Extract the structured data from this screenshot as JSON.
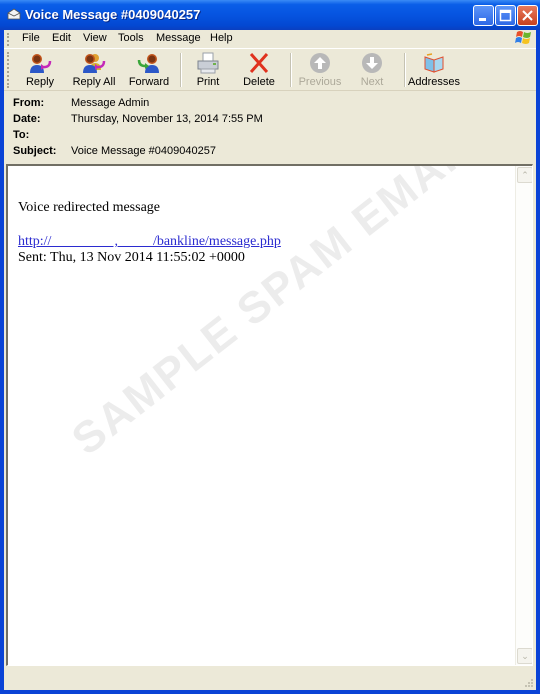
{
  "window": {
    "title": "Voice Message #0409040257",
    "controls": {
      "minimize": "minimize",
      "maximize": "maximize",
      "close": "close"
    }
  },
  "menu": {
    "items": [
      {
        "label": "File"
      },
      {
        "label": "Edit"
      },
      {
        "label": "View"
      },
      {
        "label": "Tools"
      },
      {
        "label": "Message"
      },
      {
        "label": "Help"
      }
    ]
  },
  "toolbar": {
    "buttons": [
      {
        "label": "Reply",
        "icon": "reply-icon",
        "enabled": true
      },
      {
        "label": "Reply All",
        "icon": "reply-all-icon",
        "enabled": true
      },
      {
        "label": "Forward",
        "icon": "forward-icon",
        "enabled": true
      },
      {
        "label": "Print",
        "icon": "printer-icon",
        "enabled": true
      },
      {
        "label": "Delete",
        "icon": "delete-x-icon",
        "enabled": true
      },
      {
        "label": "Previous",
        "icon": "up-arrow-icon",
        "enabled": false
      },
      {
        "label": "Next",
        "icon": "down-arrow-icon",
        "enabled": false
      },
      {
        "label": "Addresses",
        "icon": "address-book-icon",
        "enabled": true
      }
    ]
  },
  "headers": {
    "from_label": "From:",
    "from": "Message Admin",
    "date_label": "Date:",
    "date": "Thursday, November 13, 2014 7:55 PM",
    "to_label": "To:",
    "to": "",
    "subject_label": "Subject:",
    "subject": "Voice Message #0409040257"
  },
  "body": {
    "line1": "Voice redirected message",
    "link": "http://                  ,          /bankline/message.php",
    "sent": "Sent: Thu, 13 Nov 2014 11:55:02 +0000"
  },
  "watermark": "SAMPLE SPAM EMAIL",
  "colors": {
    "titlebar": "#0654e0",
    "chrome": "#ece9d8",
    "link": "#2b2bd0",
    "close_button": "#c7401e"
  }
}
